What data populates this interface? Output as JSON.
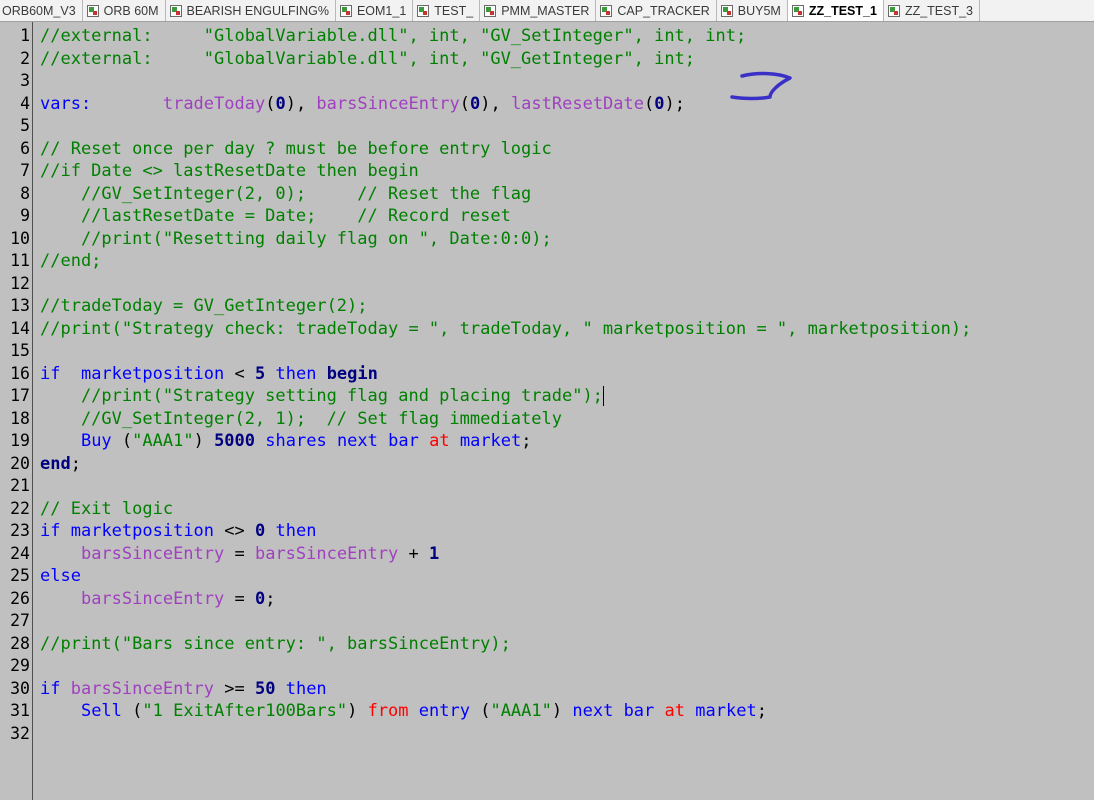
{
  "tabs": [
    {
      "label": "ORB60M_V3",
      "active": false
    },
    {
      "label": "ORB 60M",
      "active": false
    },
    {
      "label": "BEARISH ENGULFING%",
      "active": false
    },
    {
      "label": "EOM1_1",
      "active": false
    },
    {
      "label": "TEST_",
      "active": false
    },
    {
      "label": "PMM_MASTER",
      "active": false
    },
    {
      "label": "CAP_TRACKER",
      "active": false
    },
    {
      "label": "BUY5M",
      "active": false
    },
    {
      "label": "ZZ_TEST_1",
      "active": true
    },
    {
      "label": "ZZ_TEST_3",
      "active": false
    }
  ],
  "colors": {
    "background": "#c0c0c0",
    "comment": "#008000",
    "string": "#008000",
    "keyword": "#0000ff",
    "keyword_bold": "#000080",
    "variable": "#a040c0",
    "reserved": "#ff0000",
    "annotation_ink": "#3a30c8"
  },
  "editor": {
    "lines": [
      {
        "n": "1",
        "tokens": [
          {
            "t": "//external:     \"GlobalVariable.dll\", int, \"GV_SetInteger\", int, int;",
            "c": "cm"
          }
        ]
      },
      {
        "n": "2",
        "tokens": [
          {
            "t": "//external:     \"GlobalVariable.dll\", int, \"GV_GetInteger\", int;",
            "c": "cm"
          }
        ]
      },
      {
        "n": "3",
        "tokens": []
      },
      {
        "n": "4",
        "tokens": [
          {
            "t": "vars:",
            "c": "kw"
          },
          {
            "t": "       ",
            "c": "pl"
          },
          {
            "t": "tradeToday",
            "c": "var"
          },
          {
            "t": "(",
            "c": "pl"
          },
          {
            "t": "0",
            "c": "num"
          },
          {
            "t": "), ",
            "c": "pl"
          },
          {
            "t": "barsSinceEntry",
            "c": "var"
          },
          {
            "t": "(",
            "c": "pl"
          },
          {
            "t": "0",
            "c": "num"
          },
          {
            "t": "), ",
            "c": "pl"
          },
          {
            "t": "lastResetDate",
            "c": "var"
          },
          {
            "t": "(",
            "c": "pl"
          },
          {
            "t": "0",
            "c": "num"
          },
          {
            "t": ");",
            "c": "pl"
          }
        ]
      },
      {
        "n": "5",
        "tokens": []
      },
      {
        "n": "6",
        "tokens": [
          {
            "t": "// Reset once per day ? must be before entry logic",
            "c": "cm"
          }
        ]
      },
      {
        "n": "7",
        "tokens": [
          {
            "t": "//if Date <> lastResetDate then begin",
            "c": "cm"
          }
        ]
      },
      {
        "n": "8",
        "tokens": [
          {
            "t": "    //GV_SetInteger(2, 0);     // Reset the flag",
            "c": "cm"
          }
        ]
      },
      {
        "n": "9",
        "tokens": [
          {
            "t": "    //lastResetDate = Date;    // Record reset",
            "c": "cm"
          }
        ]
      },
      {
        "n": "10",
        "tokens": [
          {
            "t": "    //print(\"Resetting daily flag on \", Date:0:0);",
            "c": "cm"
          }
        ]
      },
      {
        "n": "11",
        "tokens": [
          {
            "t": "//end;",
            "c": "cm"
          }
        ]
      },
      {
        "n": "12",
        "tokens": []
      },
      {
        "n": "13",
        "tokens": [
          {
            "t": "//tradeToday = GV_GetInteger(2);",
            "c": "cm"
          }
        ]
      },
      {
        "n": "14",
        "tokens": [
          {
            "t": "//print(\"Strategy check: tradeToday = \", tradeToday, \" marketposition = \", marketposition);",
            "c": "cm"
          }
        ]
      },
      {
        "n": "15",
        "tokens": []
      },
      {
        "n": "16",
        "tokens": [
          {
            "t": "if",
            "c": "kw"
          },
          {
            "t": "  ",
            "c": "pl"
          },
          {
            "t": "marketposition",
            "c": "kw"
          },
          {
            "t": " < ",
            "c": "pl"
          },
          {
            "t": "5",
            "c": "num"
          },
          {
            "t": " ",
            "c": "pl"
          },
          {
            "t": "then",
            "c": "kw"
          },
          {
            "t": " ",
            "c": "pl"
          },
          {
            "t": "begin",
            "c": "kb"
          }
        ]
      },
      {
        "n": "17",
        "tokens": [
          {
            "t": "    //print(\"Strategy setting flag and placing trade\");",
            "c": "cm"
          },
          {
            "t": "",
            "c": "caret"
          }
        ]
      },
      {
        "n": "18",
        "tokens": [
          {
            "t": "    //GV_SetInteger(2, 1);  // Set flag immediately",
            "c": "cm"
          }
        ]
      },
      {
        "n": "19",
        "tokens": [
          {
            "t": "    ",
            "c": "pl"
          },
          {
            "t": "Buy",
            "c": "kw"
          },
          {
            "t": " (",
            "c": "pl"
          },
          {
            "t": "\"AAA1\"",
            "c": "str"
          },
          {
            "t": ") ",
            "c": "pl"
          },
          {
            "t": "5000",
            "c": "num"
          },
          {
            "t": " ",
            "c": "pl"
          },
          {
            "t": "shares",
            "c": "kw"
          },
          {
            "t": " ",
            "c": "pl"
          },
          {
            "t": "next",
            "c": "kw"
          },
          {
            "t": " ",
            "c": "pl"
          },
          {
            "t": "bar",
            "c": "kw"
          },
          {
            "t": " ",
            "c": "pl"
          },
          {
            "t": "at",
            "c": "res"
          },
          {
            "t": " ",
            "c": "pl"
          },
          {
            "t": "market",
            "c": "kw"
          },
          {
            "t": ";",
            "c": "pl"
          }
        ]
      },
      {
        "n": "20",
        "tokens": [
          {
            "t": "end",
            "c": "kb"
          },
          {
            "t": ";",
            "c": "pl"
          }
        ]
      },
      {
        "n": "21",
        "tokens": []
      },
      {
        "n": "22",
        "tokens": [
          {
            "t": "// Exit logic",
            "c": "cm"
          }
        ]
      },
      {
        "n": "23",
        "tokens": [
          {
            "t": "if",
            "c": "kw"
          },
          {
            "t": " ",
            "c": "pl"
          },
          {
            "t": "marketposition",
            "c": "kw"
          },
          {
            "t": " <> ",
            "c": "pl"
          },
          {
            "t": "0",
            "c": "num"
          },
          {
            "t": " ",
            "c": "pl"
          },
          {
            "t": "then",
            "c": "kw"
          }
        ]
      },
      {
        "n": "24",
        "tokens": [
          {
            "t": "    ",
            "c": "pl"
          },
          {
            "t": "barsSinceEntry",
            "c": "var"
          },
          {
            "t": " = ",
            "c": "pl"
          },
          {
            "t": "barsSinceEntry",
            "c": "var"
          },
          {
            "t": " + ",
            "c": "pl"
          },
          {
            "t": "1",
            "c": "num"
          }
        ]
      },
      {
        "n": "25",
        "tokens": [
          {
            "t": "else",
            "c": "kw"
          }
        ]
      },
      {
        "n": "26",
        "tokens": [
          {
            "t": "    ",
            "c": "pl"
          },
          {
            "t": "barsSinceEntry",
            "c": "var"
          },
          {
            "t": " = ",
            "c": "pl"
          },
          {
            "t": "0",
            "c": "num"
          },
          {
            "t": ";",
            "c": "pl"
          }
        ]
      },
      {
        "n": "27",
        "tokens": []
      },
      {
        "n": "28",
        "tokens": [
          {
            "t": "//print(\"Bars since entry: \", barsSinceEntry);",
            "c": "cm"
          }
        ]
      },
      {
        "n": "29",
        "tokens": []
      },
      {
        "n": "30",
        "tokens": [
          {
            "t": "if",
            "c": "kw"
          },
          {
            "t": " ",
            "c": "pl"
          },
          {
            "t": "barsSinceEntry",
            "c": "var"
          },
          {
            "t": " >= ",
            "c": "pl"
          },
          {
            "t": "50",
            "c": "num"
          },
          {
            "t": " ",
            "c": "pl"
          },
          {
            "t": "then",
            "c": "kw"
          }
        ]
      },
      {
        "n": "31",
        "tokens": [
          {
            "t": "    ",
            "c": "pl"
          },
          {
            "t": "Sell",
            "c": "kw"
          },
          {
            "t": " (",
            "c": "pl"
          },
          {
            "t": "\"1 ExitAfter100Bars\"",
            "c": "str"
          },
          {
            "t": ") ",
            "c": "pl"
          },
          {
            "t": "from",
            "c": "res"
          },
          {
            "t": " ",
            "c": "pl"
          },
          {
            "t": "entry",
            "c": "kw"
          },
          {
            "t": " (",
            "c": "pl"
          },
          {
            "t": "\"AAA1\"",
            "c": "str"
          },
          {
            "t": ") ",
            "c": "pl"
          },
          {
            "t": "next",
            "c": "kw"
          },
          {
            "t": " ",
            "c": "pl"
          },
          {
            "t": "bar",
            "c": "kw"
          },
          {
            "t": " ",
            "c": "pl"
          },
          {
            "t": "at",
            "c": "res"
          },
          {
            "t": " ",
            "c": "pl"
          },
          {
            "t": "market",
            "c": "kw"
          },
          {
            "t": ";",
            "c": "pl"
          }
        ]
      },
      {
        "n": "32",
        "tokens": []
      }
    ]
  }
}
